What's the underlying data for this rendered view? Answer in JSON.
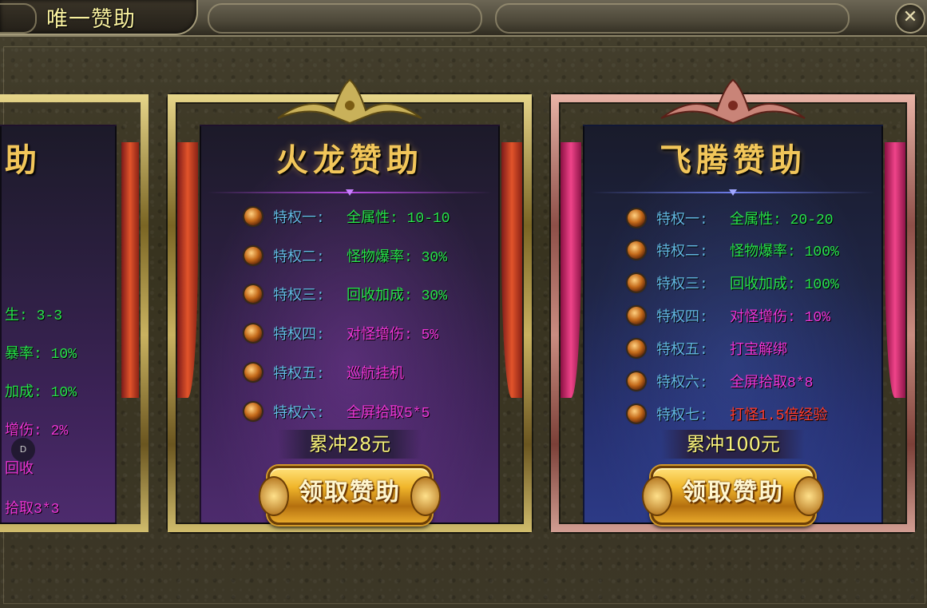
{
  "header": {
    "title": "唯一赞助",
    "close_icon": "close-icon"
  },
  "partial_card": {
    "title": "助",
    "rows": [
      {
        "text": "生: 3-3",
        "color": "green"
      },
      {
        "text": "暴率: 10%",
        "color": "green"
      },
      {
        "text": "加成: 10%",
        "color": "green"
      },
      {
        "text": "增伤: 2%",
        "color": "pink"
      },
      {
        "text": "回收",
        "color": "pink"
      },
      {
        "text": "拾取3*3",
        "color": "pink"
      }
    ],
    "badge": "D"
  },
  "cards": [
    {
      "title": "火龙赞助",
      "privileges": [
        {
          "label": "特权一:",
          "value": "全属性: 10-10",
          "color": "green"
        },
        {
          "label": "特权二:",
          "value": "怪物爆率: 30%",
          "color": "green"
        },
        {
          "label": "特权三:",
          "value": "回收加成: 30%",
          "color": "green"
        },
        {
          "label": "特权四:",
          "value": "对怪增伤: 5%",
          "color": "pink"
        },
        {
          "label": "特权五:",
          "value": "巡航挂机",
          "color": "pink"
        },
        {
          "label": "特权六:",
          "value": "全屏拾取5*5",
          "color": "pink"
        }
      ],
      "price": "累冲28元",
      "button": "领取赞助"
    },
    {
      "title": "飞腾赞助",
      "privileges": [
        {
          "label": "特权一:",
          "value": "全属性: 20-20",
          "color": "green"
        },
        {
          "label": "特权二:",
          "value": "怪物爆率: 100%",
          "color": "green"
        },
        {
          "label": "特权三:",
          "value": "回收加成: 100%",
          "color": "green"
        },
        {
          "label": "特权四:",
          "value": "对怪增伤: 10%",
          "color": "pink"
        },
        {
          "label": "特权五:",
          "value": "打宝解绑",
          "color": "pink"
        },
        {
          "label": "特权六:",
          "value": "全屏拾取8*8",
          "color": "pink"
        },
        {
          "label": "特权七:",
          "value": "打怪1.5倍经验",
          "color": "red"
        }
      ],
      "price": "累冲100元",
      "button": "领取赞助"
    }
  ]
}
